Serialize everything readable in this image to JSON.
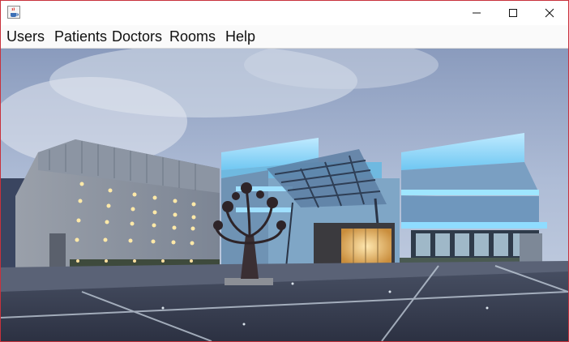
{
  "window": {
    "app_icon": "java-coffee-cup-icon",
    "controls": [
      "minimize-icon",
      "maximize-icon",
      "close-icon"
    ]
  },
  "menu": {
    "items": [
      {
        "label": "Users"
      },
      {
        "label": "Patients"
      },
      {
        "label": "Doctors"
      },
      {
        "label": "Rooms"
      },
      {
        "label": "Help"
      }
    ]
  },
  "content": {
    "image_subject": "hospital-building-photo"
  }
}
